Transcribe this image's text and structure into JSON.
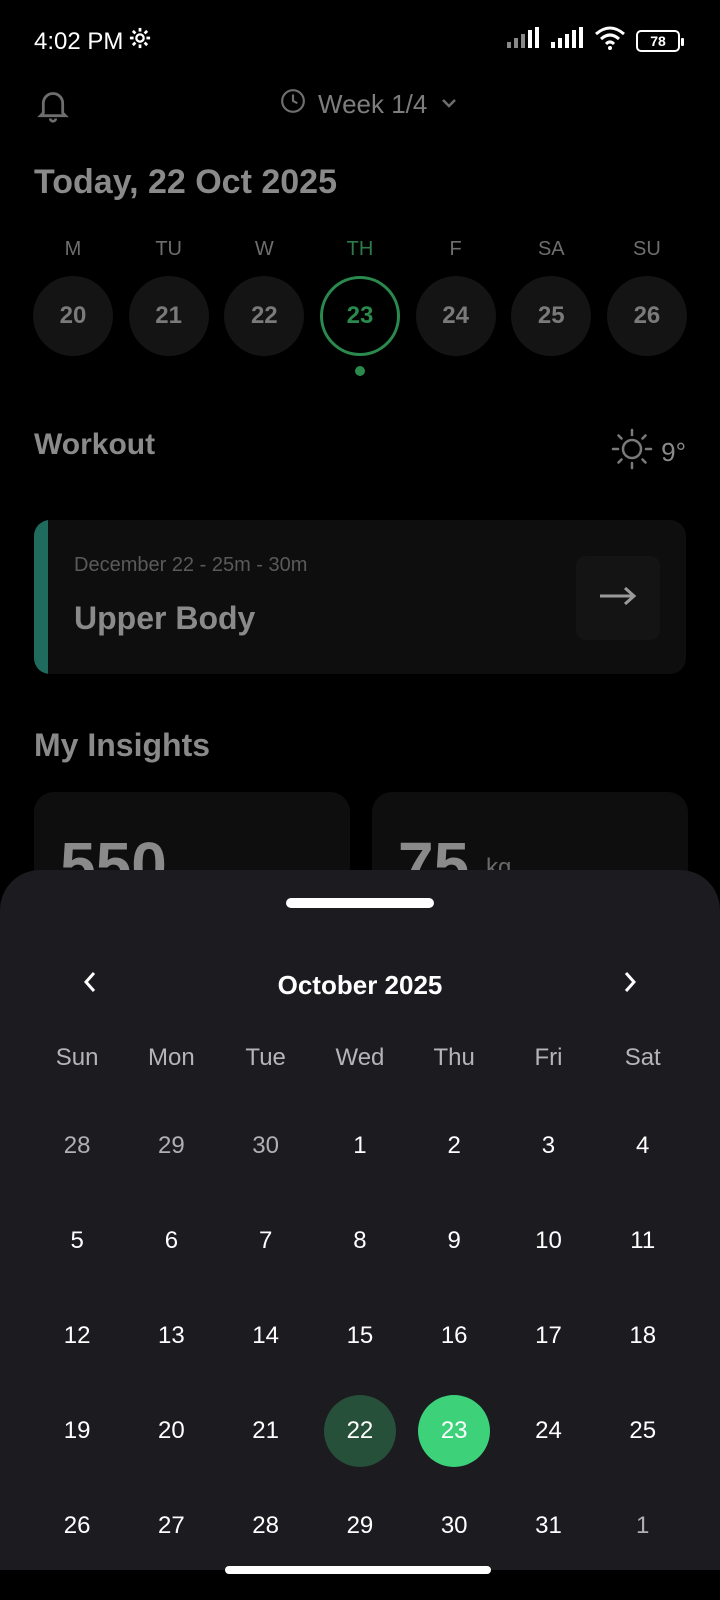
{
  "status_bar": {
    "time": "4:02 PM",
    "battery": "78"
  },
  "top_nav": {
    "week_label": "Week 1/4"
  },
  "today_title": "Today, 22 Oct 2025",
  "week_strip": [
    {
      "letter": "M",
      "date": "20",
      "active": false
    },
    {
      "letter": "TU",
      "date": "21",
      "active": false
    },
    {
      "letter": "W",
      "date": "22",
      "active": false
    },
    {
      "letter": "TH",
      "date": "23",
      "active": true
    },
    {
      "letter": "F",
      "date": "24",
      "active": false
    },
    {
      "letter": "SA",
      "date": "25",
      "active": false
    },
    {
      "letter": "SU",
      "date": "26",
      "active": false
    }
  ],
  "workout": {
    "header": "Workout",
    "weather_temp": "9°",
    "card_meta": "December 22 - 25m - 30m",
    "card_name": "Upper Body"
  },
  "insights": {
    "title": "My Insights",
    "card_left_value": "550",
    "card_right_value": "75",
    "card_right_unit": "kg"
  },
  "calendar": {
    "month_title": "October 2025",
    "weekdays": [
      "Sun",
      "Mon",
      "Tue",
      "Wed",
      "Thu",
      "Fri",
      "Sat"
    ],
    "weeks": [
      [
        {
          "d": "28",
          "muted": true
        },
        {
          "d": "29",
          "muted": true
        },
        {
          "d": "30",
          "muted": true
        },
        {
          "d": "1"
        },
        {
          "d": "2"
        },
        {
          "d": "3"
        },
        {
          "d": "4"
        }
      ],
      [
        {
          "d": "5"
        },
        {
          "d": "6"
        },
        {
          "d": "7"
        },
        {
          "d": "8"
        },
        {
          "d": "9"
        },
        {
          "d": "10"
        },
        {
          "d": "11"
        }
      ],
      [
        {
          "d": "12"
        },
        {
          "d": "13"
        },
        {
          "d": "14"
        },
        {
          "d": "15"
        },
        {
          "d": "16"
        },
        {
          "d": "17"
        },
        {
          "d": "18"
        }
      ],
      [
        {
          "d": "19"
        },
        {
          "d": "20"
        },
        {
          "d": "21"
        },
        {
          "d": "22",
          "state": "range"
        },
        {
          "d": "23",
          "state": "selected"
        },
        {
          "d": "24"
        },
        {
          "d": "25"
        }
      ],
      [
        {
          "d": "26"
        },
        {
          "d": "27"
        },
        {
          "d": "28"
        },
        {
          "d": "29"
        },
        {
          "d": "30"
        },
        {
          "d": "31"
        },
        {
          "d": "1",
          "muted": true
        }
      ]
    ]
  },
  "colors": {
    "accent_green": "#3dd27a",
    "range_green": "#26503a",
    "sheet_bg": "#1b1b20"
  }
}
